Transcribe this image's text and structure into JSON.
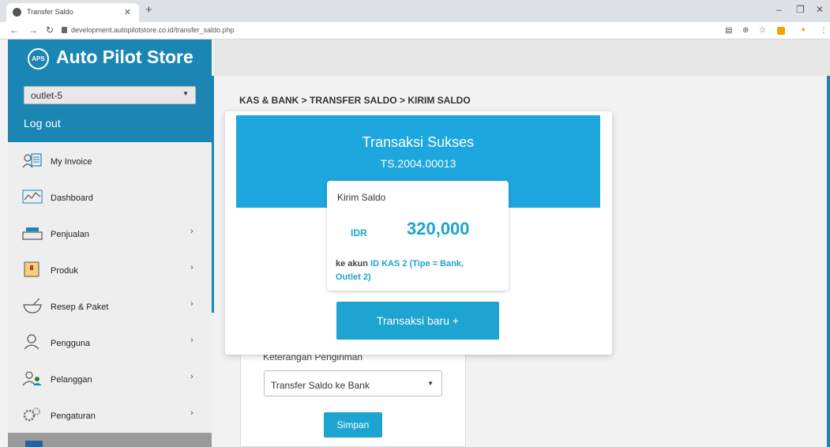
{
  "browser": {
    "tab_title": "Transfer Saldo",
    "url": "development.autopilotstore.co.id/transfer_saldo.php"
  },
  "sidebar": {
    "logo_text": "APS",
    "brand": "Auto Pilot Store",
    "outlet": "outlet-5",
    "logout": "Log out",
    "items": [
      {
        "label": "My Invoice",
        "icon": "invoice-icon"
      },
      {
        "label": "Dashboard",
        "icon": "dashboard-chart-icon"
      },
      {
        "label": "Penjualan",
        "icon": "cash-register-icon"
      },
      {
        "label": "Produk",
        "icon": "product-box-icon"
      },
      {
        "label": "Resep & Paket",
        "icon": "recipe-bowl-icon"
      },
      {
        "label": "Pengguna",
        "icon": "user-icon"
      },
      {
        "label": "Pelanggan",
        "icon": "customers-icon"
      },
      {
        "label": "Pengaturan",
        "icon": "settings-gear-icon"
      }
    ]
  },
  "main": {
    "breadcrumb": "KAS & BANK > TRANSFER SALDO > KIRIM SALDO",
    "form": {
      "label": "Keterangan Pengiriman",
      "select_value": "Transfer Saldo ke Bank",
      "save_label": "Simpan"
    }
  },
  "modal": {
    "title": "Transaksi Sukses",
    "code": "TS.2004.00013",
    "card_label": "Kirim Saldo",
    "currency": "IDR",
    "amount": "320,000",
    "dest_prefix": "ke akun",
    "dest_account": "ID KAS 2 (Tipe = Bank,",
    "dest_account2": "Outlet 2)",
    "new_button": "Transaksi baru +"
  },
  "colors": {
    "primary": "#1da4d1",
    "sidebar_header": "#1b86b3",
    "modal_header": "#1da7de"
  }
}
